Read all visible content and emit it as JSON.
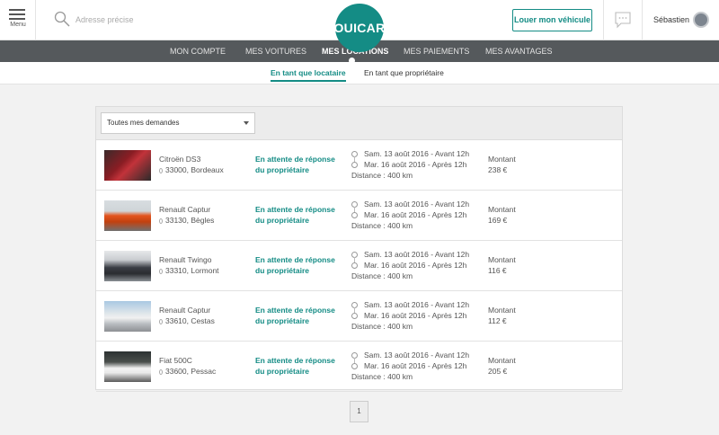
{
  "header": {
    "menu_label": "Menu",
    "search_placeholder": "Adresse précise",
    "logo_text": "OUICAR",
    "rent_button": "Louer mon véhicule",
    "user_name": "Sébastien",
    "brand_color": "#148c85"
  },
  "nav": {
    "items": [
      {
        "label": "MON COMPTE"
      },
      {
        "label": "MES VOITURES"
      },
      {
        "label": "MES LOCATIONS"
      },
      {
        "label": "MES PAIEMENTS"
      },
      {
        "label": "MES AVANTAGES"
      }
    ],
    "active": "MES LOCATIONS"
  },
  "subnav": {
    "tabs": [
      {
        "label": "En tant que locataire"
      },
      {
        "label": "En tant que propriétaire"
      }
    ],
    "active": "En tant que locataire"
  },
  "filter": {
    "selected": "Toutes mes demandes"
  },
  "rentals": [
    {
      "car": "Citroën DS3",
      "location": "33000, Bordeaux",
      "status_line1": "En attente de réponse",
      "status_line2": "du propriétaire",
      "start": "Sam. 13 août 2016 - Avant 12h",
      "end": "Mar. 16 août 2016 - Après 12h",
      "distance": "Distance : 400 km",
      "amount_label": "Montant",
      "amount": "238 €"
    },
    {
      "car": "Renault Captur",
      "location": "33130, Bègles",
      "status_line1": "En attente de réponse",
      "status_line2": "du propriétaire",
      "start": "Sam. 13 août 2016 - Avant 12h",
      "end": "Mar. 16 août 2016 - Après 12h",
      "distance": "Distance : 400 km",
      "amount_label": "Montant",
      "amount": "169 €"
    },
    {
      "car": "Renault Twingo",
      "location": "33310, Lormont",
      "status_line1": "En attente de réponse",
      "status_line2": "du propriétaire",
      "start": "Sam. 13 août 2016 - Avant 12h",
      "end": "Mar. 16 août 2016 - Après 12h",
      "distance": "Distance : 400 km",
      "amount_label": "Montant",
      "amount": "116 €"
    },
    {
      "car": "Renault Captur",
      "location": "33610, Cestas",
      "status_line1": "En attente de réponse",
      "status_line2": "du propriétaire",
      "start": "Sam. 13 août 2016 - Avant 12h",
      "end": "Mar. 16 août 2016 - Après 12h",
      "distance": "Distance : 400 km",
      "amount_label": "Montant",
      "amount": "112 €"
    },
    {
      "car": "Fiat 500C",
      "location": "33600, Pessac",
      "status_line1": "En attente de réponse",
      "status_line2": "du propriétaire",
      "start": "Sam. 13 août 2016 - Avant 12h",
      "end": "Mar. 16 août 2016 - Après 12h",
      "distance": "Distance : 400 km",
      "amount_label": "Montant",
      "amount": "205 €"
    }
  ],
  "pagination": {
    "current": "1"
  }
}
